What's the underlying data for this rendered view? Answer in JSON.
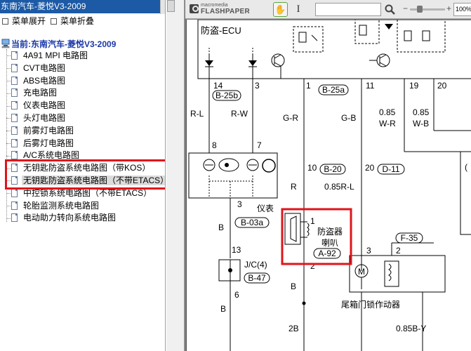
{
  "window": {
    "title": "东南汽车-菱悦V3-2009"
  },
  "menu": {
    "expand_label": "菜单展开",
    "collapse_label": "菜单折叠"
  },
  "tree": {
    "root_label": "当前:东南汽车-菱悦V3-2009",
    "items": [
      {
        "label": "4A91 MPI 电路图"
      },
      {
        "label": "CVT电路图"
      },
      {
        "label": "ABS电路图"
      },
      {
        "label": "充电路图"
      },
      {
        "label": "仪表电路图"
      },
      {
        "label": "头灯电路图"
      },
      {
        "label": "前雾灯电路图"
      },
      {
        "label": "后雾灯电路图"
      },
      {
        "label": "A/C系统电路图"
      },
      {
        "label": "无钥匙防盗系统电路图（带KOS）"
      },
      {
        "label": "无钥匙防盗系统电路图（不带ETACS）"
      },
      {
        "label": "中控锁系统电路图（不带ETACS）"
      },
      {
        "label": "轮胎监测系统电路图"
      },
      {
        "label": "电动助力转向系统电路图"
      }
    ],
    "selected_index": 10
  },
  "viewer": {
    "logo_small": "macromedia",
    "logo_big": "FLASHPAPER",
    "find_value": "",
    "zoom": "100%"
  },
  "icons": {
    "hand": "hand-tool-icon",
    "text": "text-select-icon",
    "search": "search-icon",
    "zoom_minus": "zoom-out-icon",
    "zoom_plus": "zoom-in-icon",
    "root": "computer-icon",
    "doc": "document-icon"
  },
  "schematic": {
    "ecu_label": "防盗-ECU",
    "pins_top": [
      "14",
      "3",
      "1",
      "11",
      "19",
      "20"
    ],
    "conn_b25b": "B-25b",
    "conn_b25a": "B-25a",
    "wire_rl": "R-L",
    "wire_rw": "R-W",
    "wire_gr": "G-R",
    "wire_gb": "G-B",
    "wire_085_a": "0.85",
    "wire_wr": "W-R",
    "wire_085_b": "0.85",
    "wire_wb": "W-B",
    "pin_8": "8",
    "pin_7": "7",
    "pin_10": "10",
    "conn_b20": "B-20",
    "pin_20": "20",
    "conn_d11": "D-11",
    "wire_r": "R",
    "wire_085rl": "0.85R-L",
    "meter_pin": "3",
    "meter_label": "仪表",
    "wire_b_1": "B",
    "conn_b03a": "B-03a",
    "siren_pin1": "1",
    "siren_pin2": "2",
    "siren_label_1": "防盗器",
    "siren_label_2": "喇叭",
    "conn_a92": "A-92",
    "pin_3b": "3",
    "pin_2b": "2",
    "conn_f35": "F-35",
    "pin_13": "13",
    "jc_label": "J/C(4)",
    "conn_b47": "B-47",
    "pin_6": "6",
    "wire_b_2": "B",
    "wire_b_3": "B",
    "wire_b_4": "B",
    "motor_label": "M",
    "actuator_label": "尾箱门锁作动器",
    "wire_2b": "2B",
    "wire_085by": "0.85B-Y",
    "partial_label": "("
  },
  "colors": {
    "titlebar": "#1c5aa6",
    "root_text": "#1c38a8",
    "highlight_box": "#e0141b",
    "selected_bg": "#dcdcdc",
    "viewer_bg": "#7d7d7d"
  }
}
